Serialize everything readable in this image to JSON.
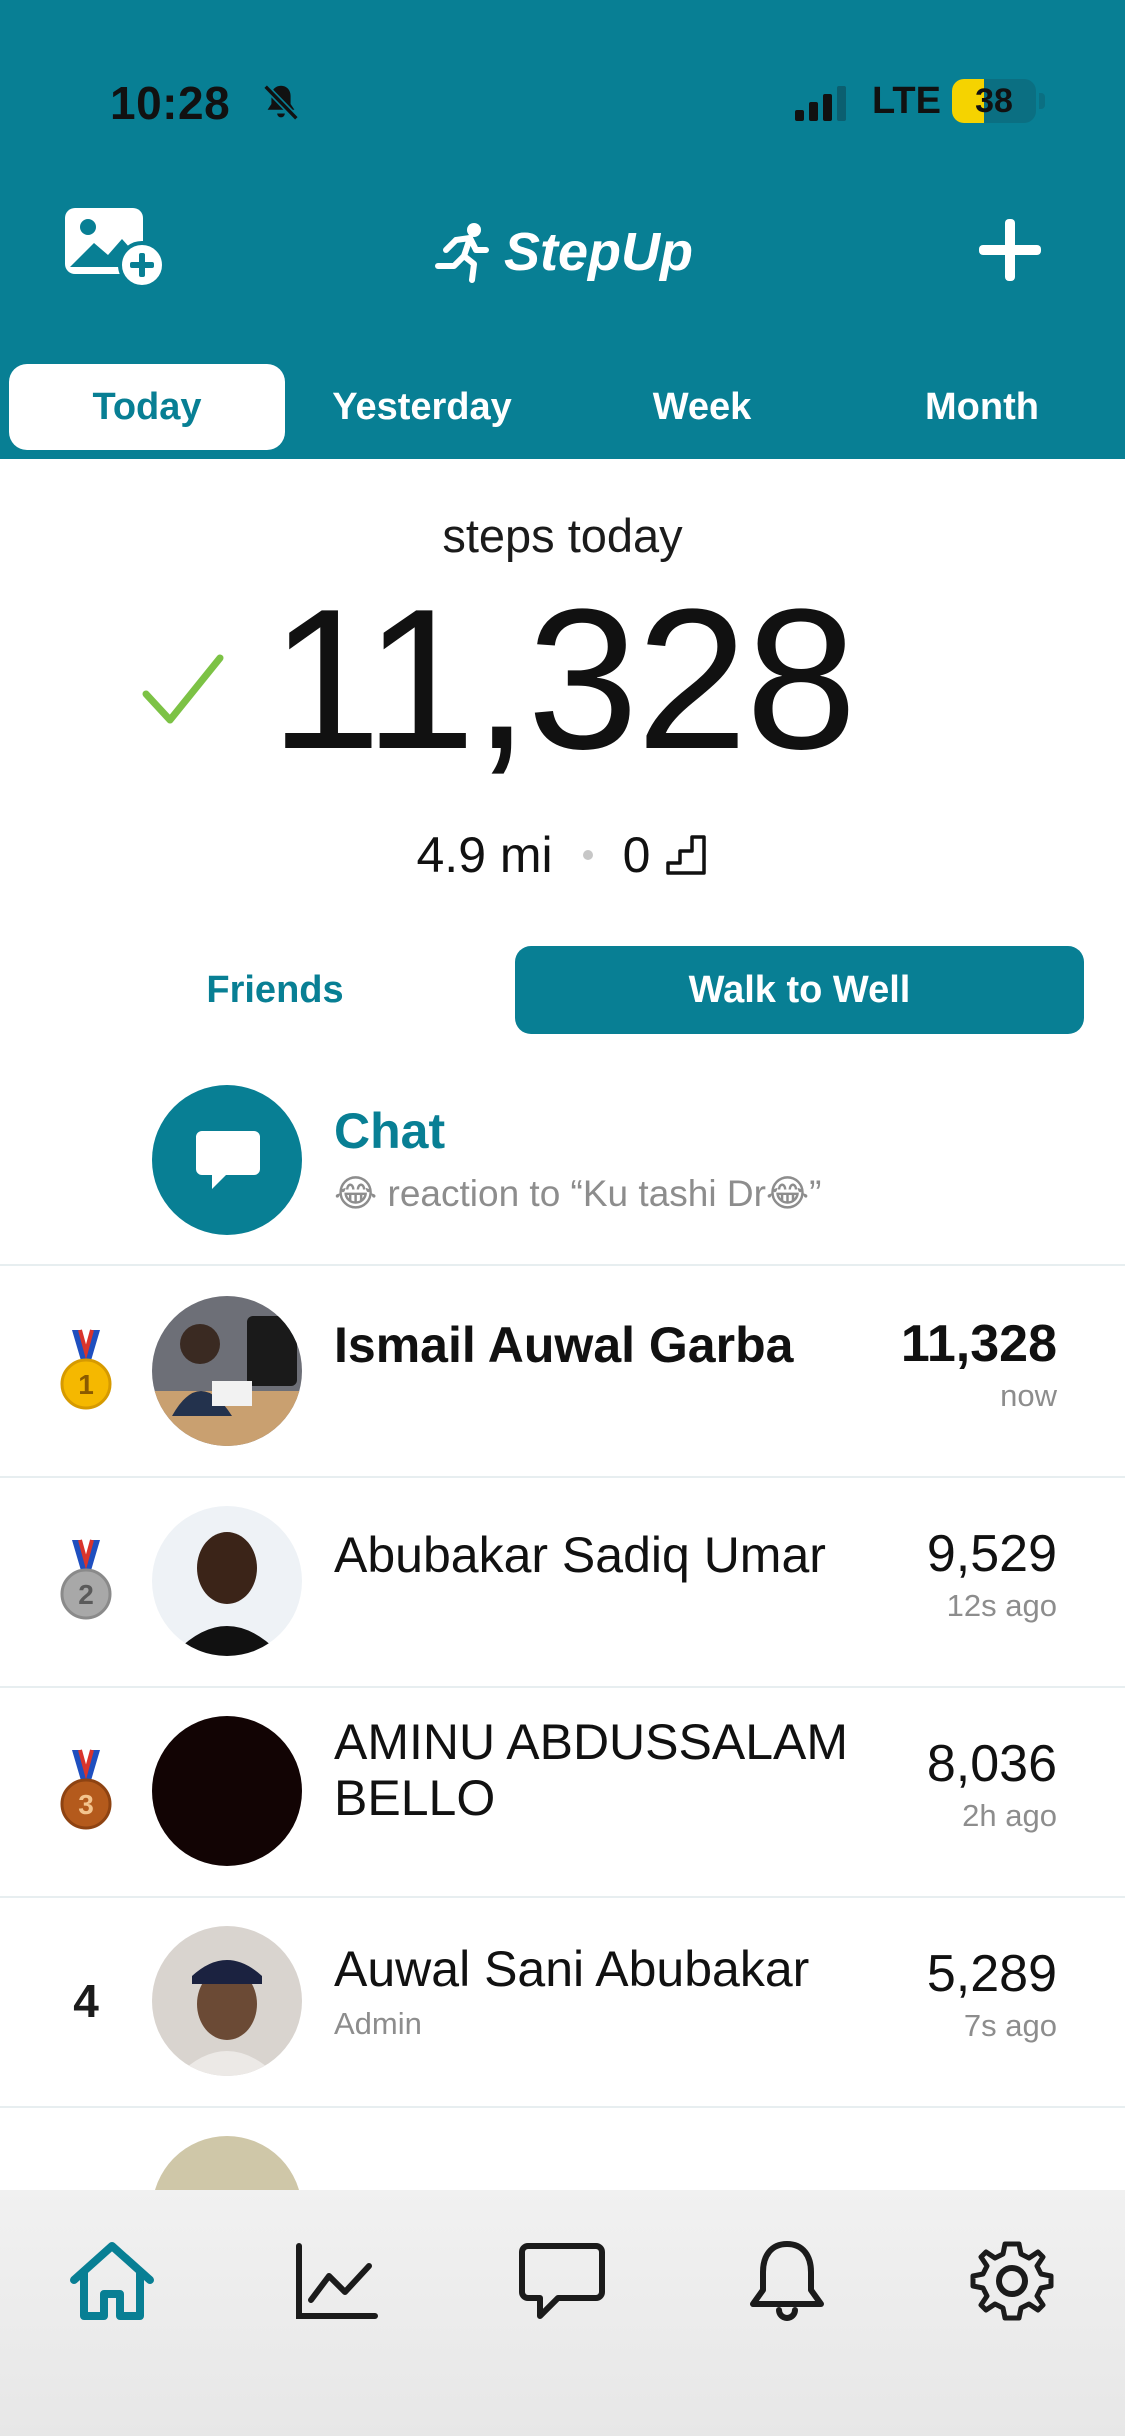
{
  "status_bar": {
    "time": "10:28",
    "network": "LTE",
    "battery": "38",
    "battery_level": 0.38
  },
  "header": {
    "app_name": "StepUp",
    "icons": [
      "add-photo-icon",
      "runner-icon",
      "plus-icon"
    ],
    "color": "#087f94"
  },
  "tabs": [
    {
      "label": "Today",
      "active": true
    },
    {
      "label": "Yesterday",
      "active": false
    },
    {
      "label": "Week",
      "active": false
    },
    {
      "label": "Month",
      "active": false
    }
  ],
  "summary": {
    "subtitle": "steps today",
    "steps": "11,328",
    "distance": "4.9 mi",
    "floors": "0",
    "goal_met_color": "#7cc245"
  },
  "segments": {
    "friends": "Friends",
    "group": "Walk to Well",
    "active": "group"
  },
  "chat": {
    "title": "Chat",
    "preview": "😂 reaction to “Ku tashi Dr😂”"
  },
  "leaderboard": [
    {
      "rank": "1",
      "medal": "gold",
      "name": "Ismail Auwal Garba",
      "role": "",
      "steps": "11,328",
      "time": "now"
    },
    {
      "rank": "2",
      "medal": "silver",
      "name": "Abubakar Sadiq Umar",
      "role": "",
      "steps": "9,529",
      "time": "12s ago"
    },
    {
      "rank": "3",
      "medal": "bronze",
      "name": "AMINU ABDUSSALAM BELLO",
      "role": "",
      "steps": "8,036",
      "time": "2h ago"
    },
    {
      "rank": "4",
      "medal": "",
      "name": "Auwal Sani Abubakar",
      "role": "Admin",
      "steps": "5,289",
      "time": "7s ago"
    }
  ],
  "bottom_nav": [
    {
      "icon": "home-icon",
      "active": true
    },
    {
      "icon": "chart-icon",
      "active": false
    },
    {
      "icon": "chat-icon",
      "active": false
    },
    {
      "icon": "bell-icon",
      "active": false
    },
    {
      "icon": "gear-icon",
      "active": false
    }
  ]
}
